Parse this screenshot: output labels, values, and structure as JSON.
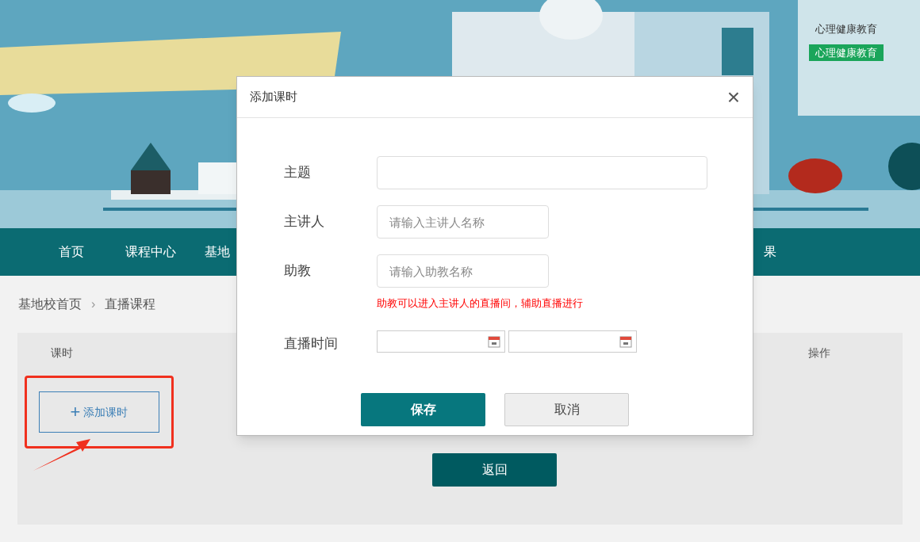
{
  "side_panel": {
    "items": [
      {
        "label": "心理健康教育",
        "selected": false
      },
      {
        "label": "心理健康教育",
        "selected": true
      }
    ]
  },
  "nav": {
    "items": [
      {
        "label": "首页"
      },
      {
        "label": "课程中心"
      },
      {
        "label": "基地"
      },
      {
        "label": "果"
      }
    ]
  },
  "breadcrumb": [
    "基地校首页",
    "›",
    "直播课程"
  ],
  "table": {
    "columns": [
      "课时",
      "操作"
    ]
  },
  "add_lesson_button": {
    "icon": "+",
    "label": "添加课时"
  },
  "back_button": "返回",
  "dialog": {
    "title": "添加课时",
    "close": "×",
    "fields": [
      {
        "label": "主题",
        "kind": "text"
      },
      {
        "label": "主讲人",
        "kind": "text",
        "placeholder": "请输入主讲人名称"
      },
      {
        "label": "助教",
        "kind": "text",
        "placeholder": "请输入助教名称",
        "hint": "助教可以进入主讲人的直播间，辅助直播进行"
      },
      {
        "label": "直播时间",
        "kind": "dates"
      }
    ],
    "buttons": [
      {
        "label": "保存",
        "kind": "primary"
      },
      {
        "label": "取消",
        "kind": "secondary"
      }
    ]
  }
}
